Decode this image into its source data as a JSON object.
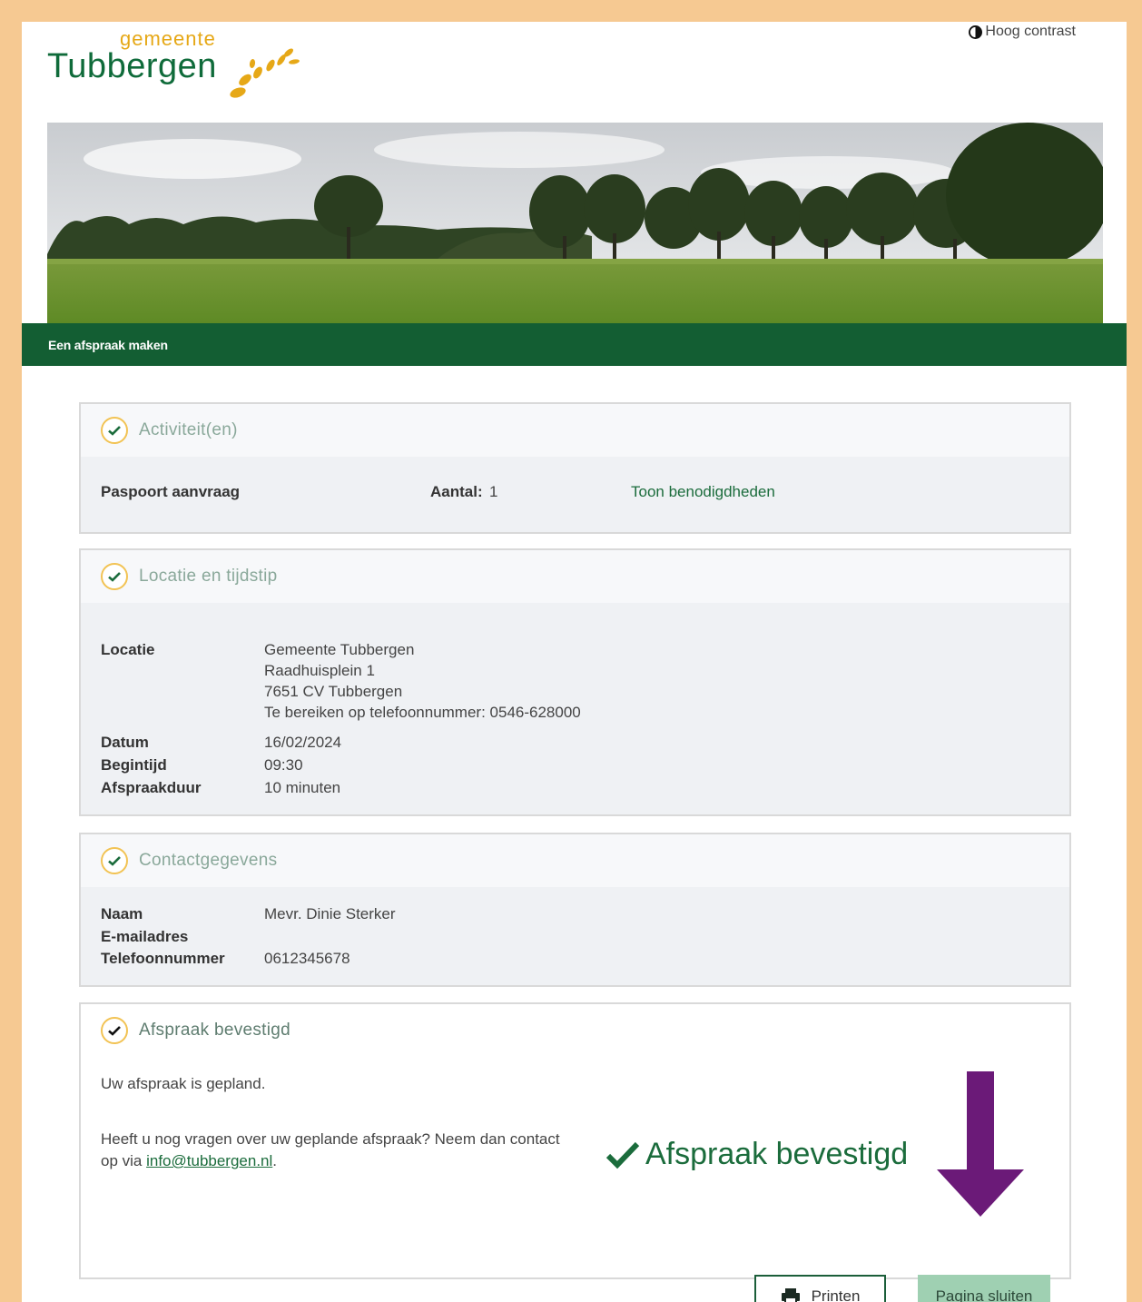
{
  "header": {
    "logo_small": "gemeente",
    "logo_big": "Tubbergen",
    "contrast_label": "Hoog contrast"
  },
  "nav": {
    "breadcrumb": "Een afspraak maken"
  },
  "colors": {
    "brand_green": "#135e33",
    "accent_yellow": "#e6a817",
    "arrow_purple": "#6b1a78",
    "close_button": "#9fd0b2"
  },
  "sections": {
    "activities": {
      "title": "Activiteit(en)",
      "item": "Paspoort aanvraag",
      "count_label": "Aantal:",
      "count_value": "1",
      "link": "Toon benodigdheden"
    },
    "location": {
      "title": "Locatie en tijdstip",
      "location_label": "Locatie",
      "address": [
        "Gemeente Tubbergen",
        "Raadhuisplein 1",
        "7651 CV Tubbergen",
        "Te bereiken op telefoonnummer: 0546-628000"
      ],
      "date_label": "Datum",
      "date_value": "16/02/2024",
      "start_label": "Begintijd",
      "start_value": "09:30",
      "duration_label": "Afspraakduur",
      "duration_value": "10 minuten"
    },
    "contact": {
      "title": "Contactgegevens",
      "name_label": "Naam",
      "name_value": "Mevr. Dinie Sterker",
      "email_label": "E-mailadres",
      "phone_label": "Telefoonnummer",
      "phone_value": "0612345678"
    },
    "confirmed": {
      "title": "Afspraak bevestigd",
      "planned_text": "Uw afspraak is gepland.",
      "question_line1": "Heeft u nog vragen over uw geplande afspraak? Neem dan contact",
      "question_prefix": "op via ",
      "email_link": "info@tubbergen.nl",
      "question_suffix": ".",
      "big_confirm": "Afspraak bevestigd",
      "print_button": "Printen",
      "close_button": "Pagina sluiten"
    }
  }
}
